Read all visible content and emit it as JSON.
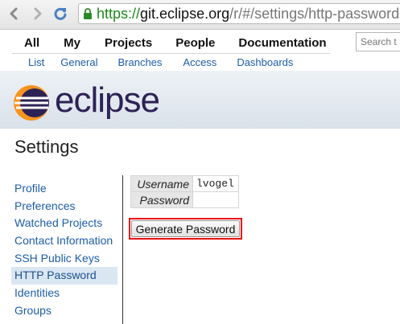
{
  "browser": {
    "url_scheme": "https://",
    "url_host": "git.eclipse.org",
    "url_path": "/r/#/settings/http-password"
  },
  "top_menu": [
    "All",
    "My",
    "Projects",
    "People",
    "Documentation"
  ],
  "search": {
    "placeholder": "Search t"
  },
  "sub_menu": [
    "List",
    "General",
    "Branches",
    "Access",
    "Dashboards"
  ],
  "logo": {
    "text": "eclipse"
  },
  "page": {
    "title": "Settings"
  },
  "sidebar": {
    "items": [
      "Profile",
      "Preferences",
      "Watched Projects",
      "Contact Information",
      "SSH Public Keys",
      "HTTP Password",
      "Identities",
      "Groups"
    ],
    "active": "HTTP Password"
  },
  "form": {
    "username_label": "Username",
    "username_value": "lvogel",
    "password_label": "Password",
    "password_value": "",
    "generate_label": "Generate Password"
  },
  "colors": {
    "link": "#1d5da8",
    "url_secure": "#1a8a1a",
    "highlight_border": "#e11111",
    "logo_purple": "#2c2255",
    "logo_orange": "#f7941e"
  }
}
